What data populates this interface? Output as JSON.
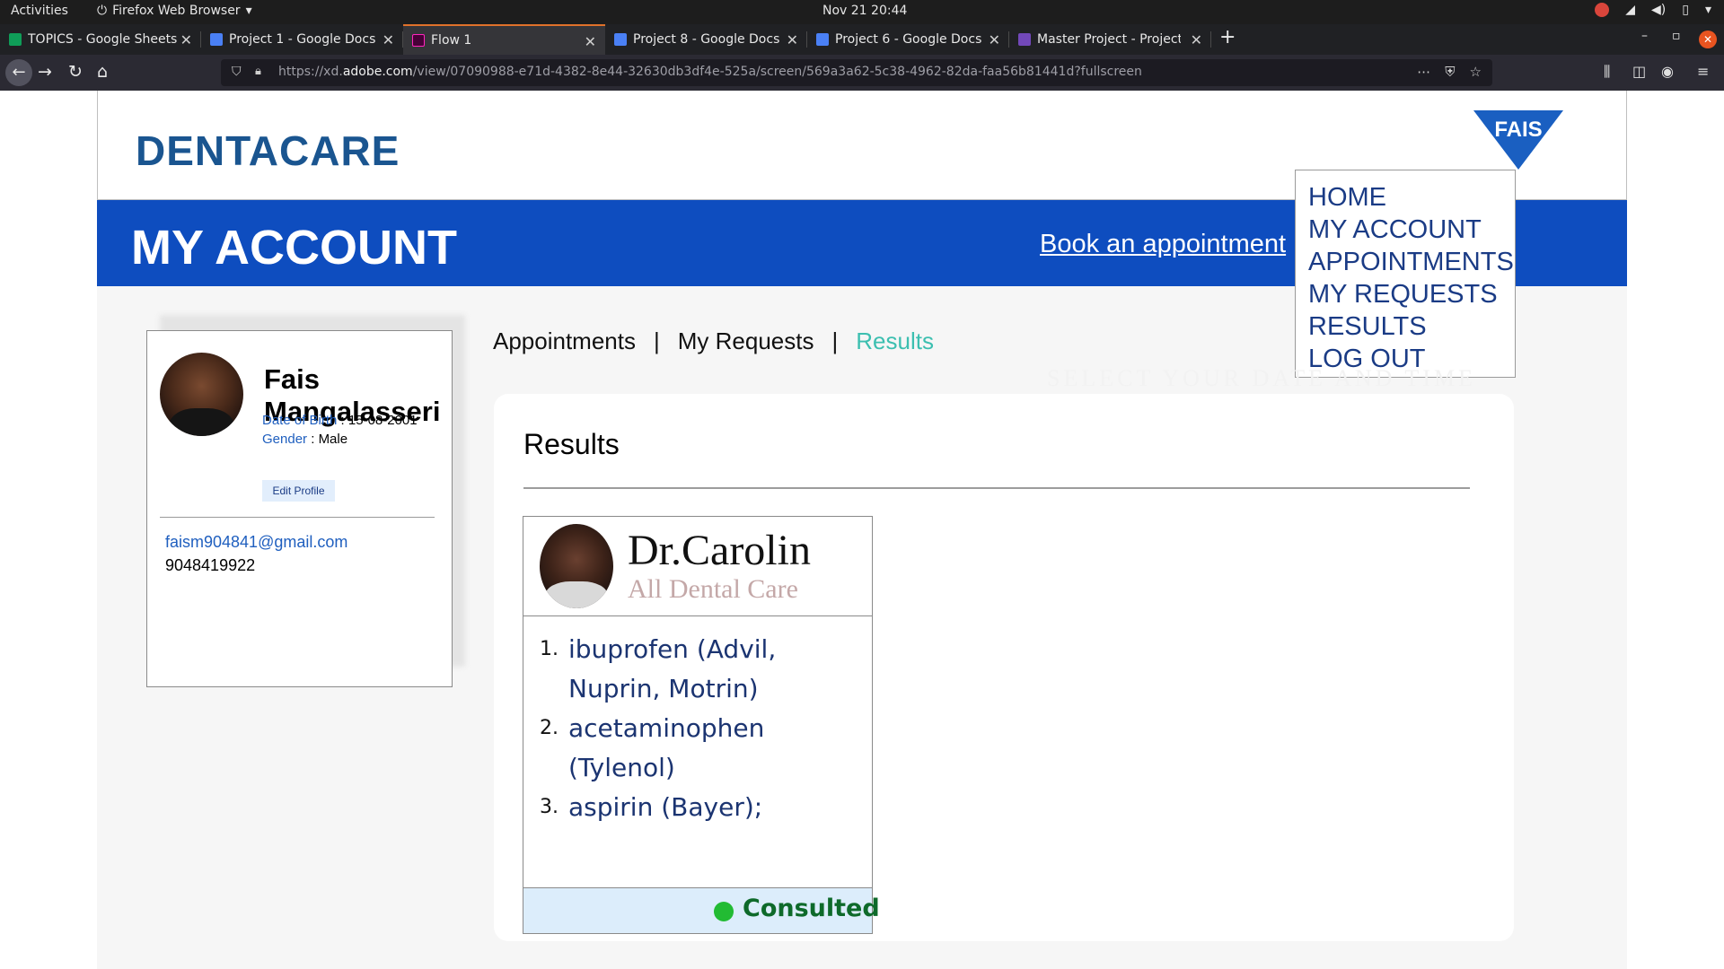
{
  "system": {
    "activities": "Activities",
    "app_name": "Firefox Web Browser",
    "clock": "Nov 21  20:44"
  },
  "tabs": [
    {
      "title": "TOPICS - Google Sheets",
      "icon": "sheets-icon",
      "color": "#0f9d58"
    },
    {
      "title": "Project 1 - Google Docs",
      "icon": "docs-icon",
      "color": "#4a80f5"
    },
    {
      "title": "Flow 1",
      "icon": "xd-icon",
      "color": "#ff26be"
    },
    {
      "title": "Project 8 - Google Docs",
      "icon": "docs-icon",
      "color": "#4a80f5"
    },
    {
      "title": "Project 6 - Google Docs",
      "icon": "docs-icon",
      "color": "#4a80f5"
    },
    {
      "title": "Master Project - Project",
      "icon": "project-icon",
      "color": "#7248b9"
    }
  ],
  "urlbar": {
    "scheme": "https://xd.",
    "host": "adobe.com",
    "path": "/view/07090988-e71d-4382-8e44-32630db3df4e-525a/screen/569a3a62-5c38-4962-82da-faa56b81441d?fullscreen"
  },
  "site": {
    "logo": "DENTACARE",
    "badge": "FAIS",
    "page_title": "MY ACCOUNT",
    "book_link": "Book an appointment"
  },
  "menu": [
    "HOME",
    "MY ACCOUNT",
    "APPOINTMENTS",
    "MY REQUESTS",
    "RESULTS",
    "LOG OUT"
  ],
  "profile": {
    "name": "Fais Mangalasseri",
    "dob_label": "Date of Birth",
    "dob": "15-08-2001",
    "gender_label": "Gender",
    "gender": "Male",
    "edit": "Edit Profile",
    "email": "faism904841@gmail.com",
    "phone": "9048419922"
  },
  "subnav": {
    "appointments": "Appointments",
    "requests": "My Requests",
    "results": "Results",
    "separator": "|"
  },
  "ghost_text": "SELECT YOUR DATE AND TIME",
  "results": {
    "title": "Results",
    "doctor": "Dr.Carolin",
    "clinic": "All Dental Care",
    "medications": [
      {
        "num": "1.",
        "text": "ibuprofen (Advil, Nuprin, Motrin)"
      },
      {
        "num": "2.",
        "text": "acetaminophen (Tylenol)"
      },
      {
        "num": "3.",
        "text": "aspirin (Bayer);"
      }
    ],
    "status": "Consulted"
  },
  "colors": {
    "brand_blue": "#0e4dbf",
    "logo_blue": "#1a5590",
    "active_teal": "#3cbfb0",
    "status_green": "#22bb33"
  }
}
